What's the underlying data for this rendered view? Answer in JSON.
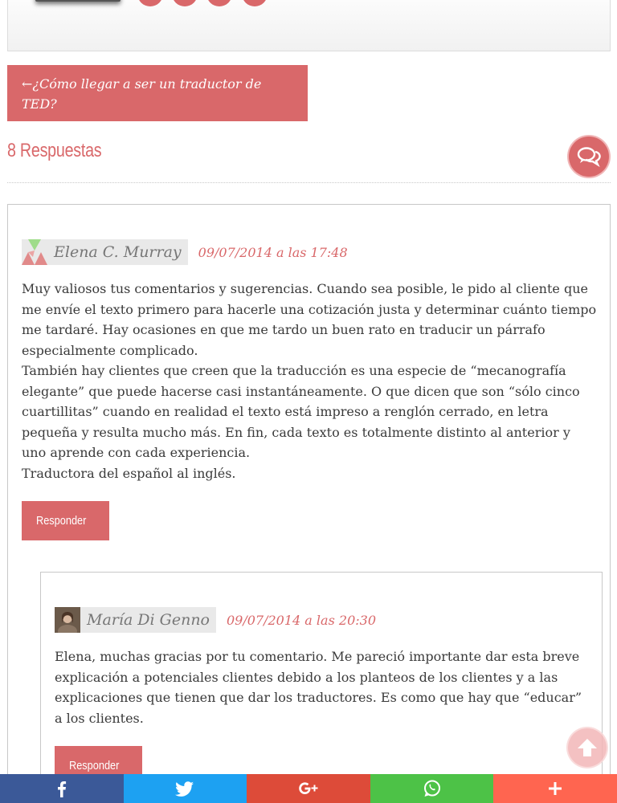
{
  "author_box": {
    "social_color": "#d9686a"
  },
  "prev_post": {
    "arrow": "←",
    "label": "¿Cómo llegar a ser un traductor de TED?"
  },
  "responses": {
    "title": "8 Respuestas",
    "icon": "comments-icon"
  },
  "comments": [
    {
      "author": "Elena C. Murray",
      "date": "09/07/2014 a las 17:48",
      "avatar": "identicon-avatar",
      "paragraphs": [
        "Muy valiosos tus comentarios y sugerencias. Cuando sea posible, le pido al cliente que me envíe el texto primero para hacerle una cotización justa y determinar cuánto tiempo me tardaré. Hay ocasiones en que me tardo un buen rato en traducir un párrafo especialmente complicado.",
        "También hay clientes que creen que la traducción es una especie de “mecanografía elegante” que puede hacerse casi instantáneamente. O que dicen que son “sólo cinco cuartillitas” cuando en realidad el texto está impreso a renglón cerrado, en letra pequeña y resulta mucho más. En fin, cada texto es totalmente distinto al anterior y uno aprende con cada experiencia.",
        "Traductora del español al inglés."
      ],
      "reply_label": "Responder"
    },
    {
      "author": "María Di Genno",
      "date": "09/07/2014 a las 20:30",
      "avatar": "photo-avatar",
      "paragraphs": [
        "Elena, muchas gracias por tu comentario. Me pareció importante dar esta breve explicación a potenciales clientes debido a los planteos de los clientes y a las explicaciones que tienen que dar los traductores. Es como que hay que “educar” a los clientes."
      ],
      "reply_label": "Responder"
    }
  ],
  "back_to_top": {
    "icon": "arrow-up-icon"
  },
  "share_bar": [
    {
      "network": "facebook",
      "icon": "facebook-icon",
      "color": "#3b5998"
    },
    {
      "network": "twitter",
      "icon": "twitter-icon",
      "color": "#1da1f2"
    },
    {
      "network": "google-plus",
      "icon": "google-plus-icon",
      "color": "#dd4b39"
    },
    {
      "network": "whatsapp",
      "icon": "whatsapp-icon",
      "color": "#4dc247"
    },
    {
      "network": "more",
      "icon": "plus-icon",
      "color": "#ff6550"
    }
  ],
  "colors": {
    "accent": "#d9686a",
    "name_bg": "#e9e9e9",
    "border": "#c8c8c8"
  }
}
